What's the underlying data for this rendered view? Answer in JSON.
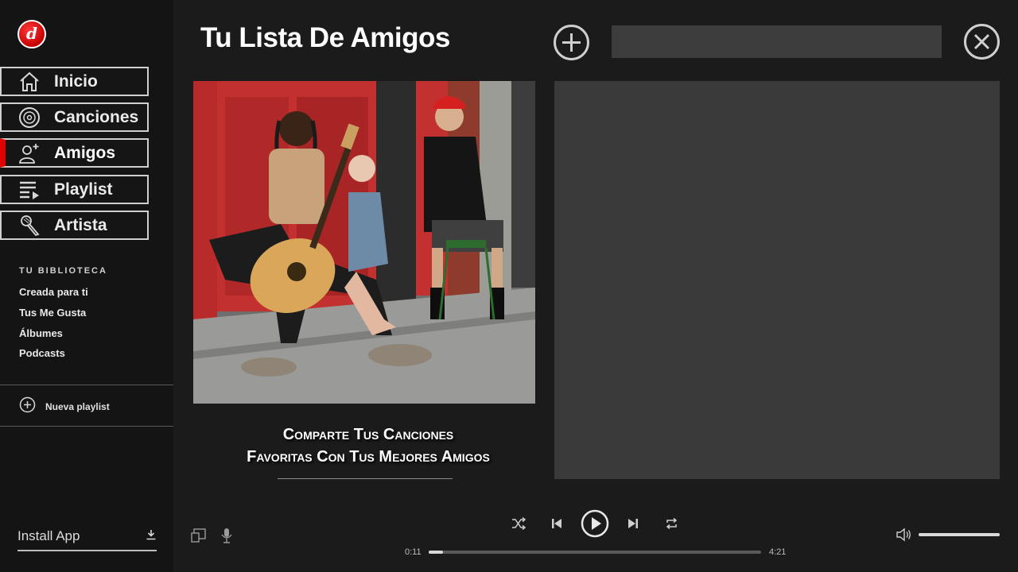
{
  "header": {
    "title": "Tu Lista De Amigos",
    "search_placeholder": ""
  },
  "nav": [
    {
      "label": "Inicio",
      "icon": "home-icon"
    },
    {
      "label": "Canciones",
      "icon": "disc-icon"
    },
    {
      "label": "Amigos",
      "icon": "add-friend-icon",
      "active": true
    },
    {
      "label": "Playlist",
      "icon": "playlist-icon"
    },
    {
      "label": "Artista",
      "icon": "microphone-icon"
    }
  ],
  "library": {
    "title": "TU BIBLIOTECA",
    "items": [
      "Creada para ti",
      "Tus Me Gusta",
      "Álbumes",
      "Podcasts"
    ]
  },
  "new_playlist": {
    "label": "Nueva playlist"
  },
  "install": {
    "label": "Install App"
  },
  "content": {
    "caption_line1": "Comparte Tus Canciones",
    "caption_line2": "Favoritas Con Tus Mejores Amigos"
  },
  "player": {
    "elapsed": "0:11",
    "duration": "4:21",
    "progress_fraction": 0.042,
    "volume_fraction": 1.0
  },
  "colors": {
    "accent": "#e00000",
    "panel": "#3a3a3a",
    "sidebar": "#141414",
    "background": "#1b1b1b"
  }
}
